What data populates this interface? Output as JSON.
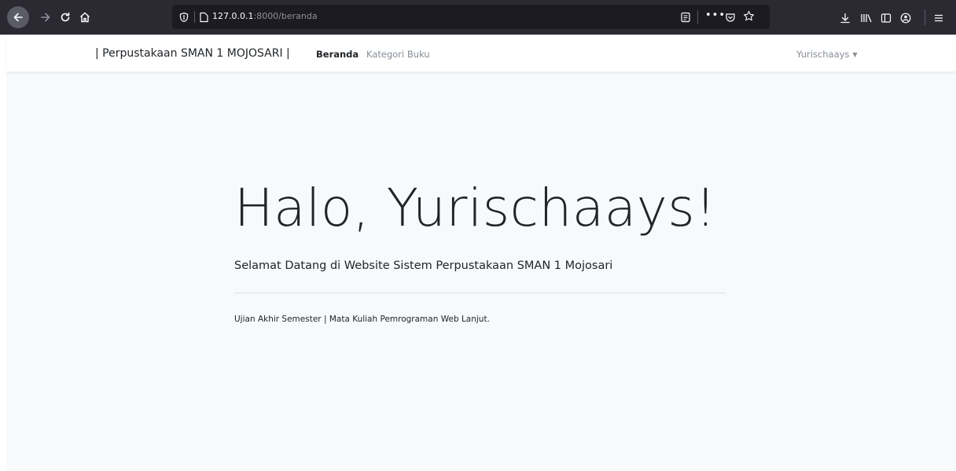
{
  "browser": {
    "url_host": "127.0.0.1",
    "url_path": ":8000/beranda",
    "icons": [
      "back-icon",
      "forward-icon",
      "reload-icon",
      "home-icon",
      "shield-icon",
      "page-icon",
      "reader-view-icon",
      "more-icon",
      "pocket-icon",
      "bookmark-star-icon",
      "download-icon",
      "library-icon",
      "sidebar-icon",
      "account-icon",
      "menu-icon"
    ]
  },
  "navbar": {
    "brand": "| Perpustakaan SMAN 1 MOJOSARI |",
    "links": [
      {
        "label": "Beranda",
        "active": true
      },
      {
        "label": "Kategori Buku",
        "active": false
      }
    ],
    "user": "Yurischaays"
  },
  "hero": {
    "title": "Halo, Yurischaays!",
    "lead": "Selamat Datang di Website Sistem Perpustakaan SMAN 1 Mojosari",
    "note": "Ujian Akhir Semester | Mata Kuliah Pemrograman Web Lanjut."
  }
}
